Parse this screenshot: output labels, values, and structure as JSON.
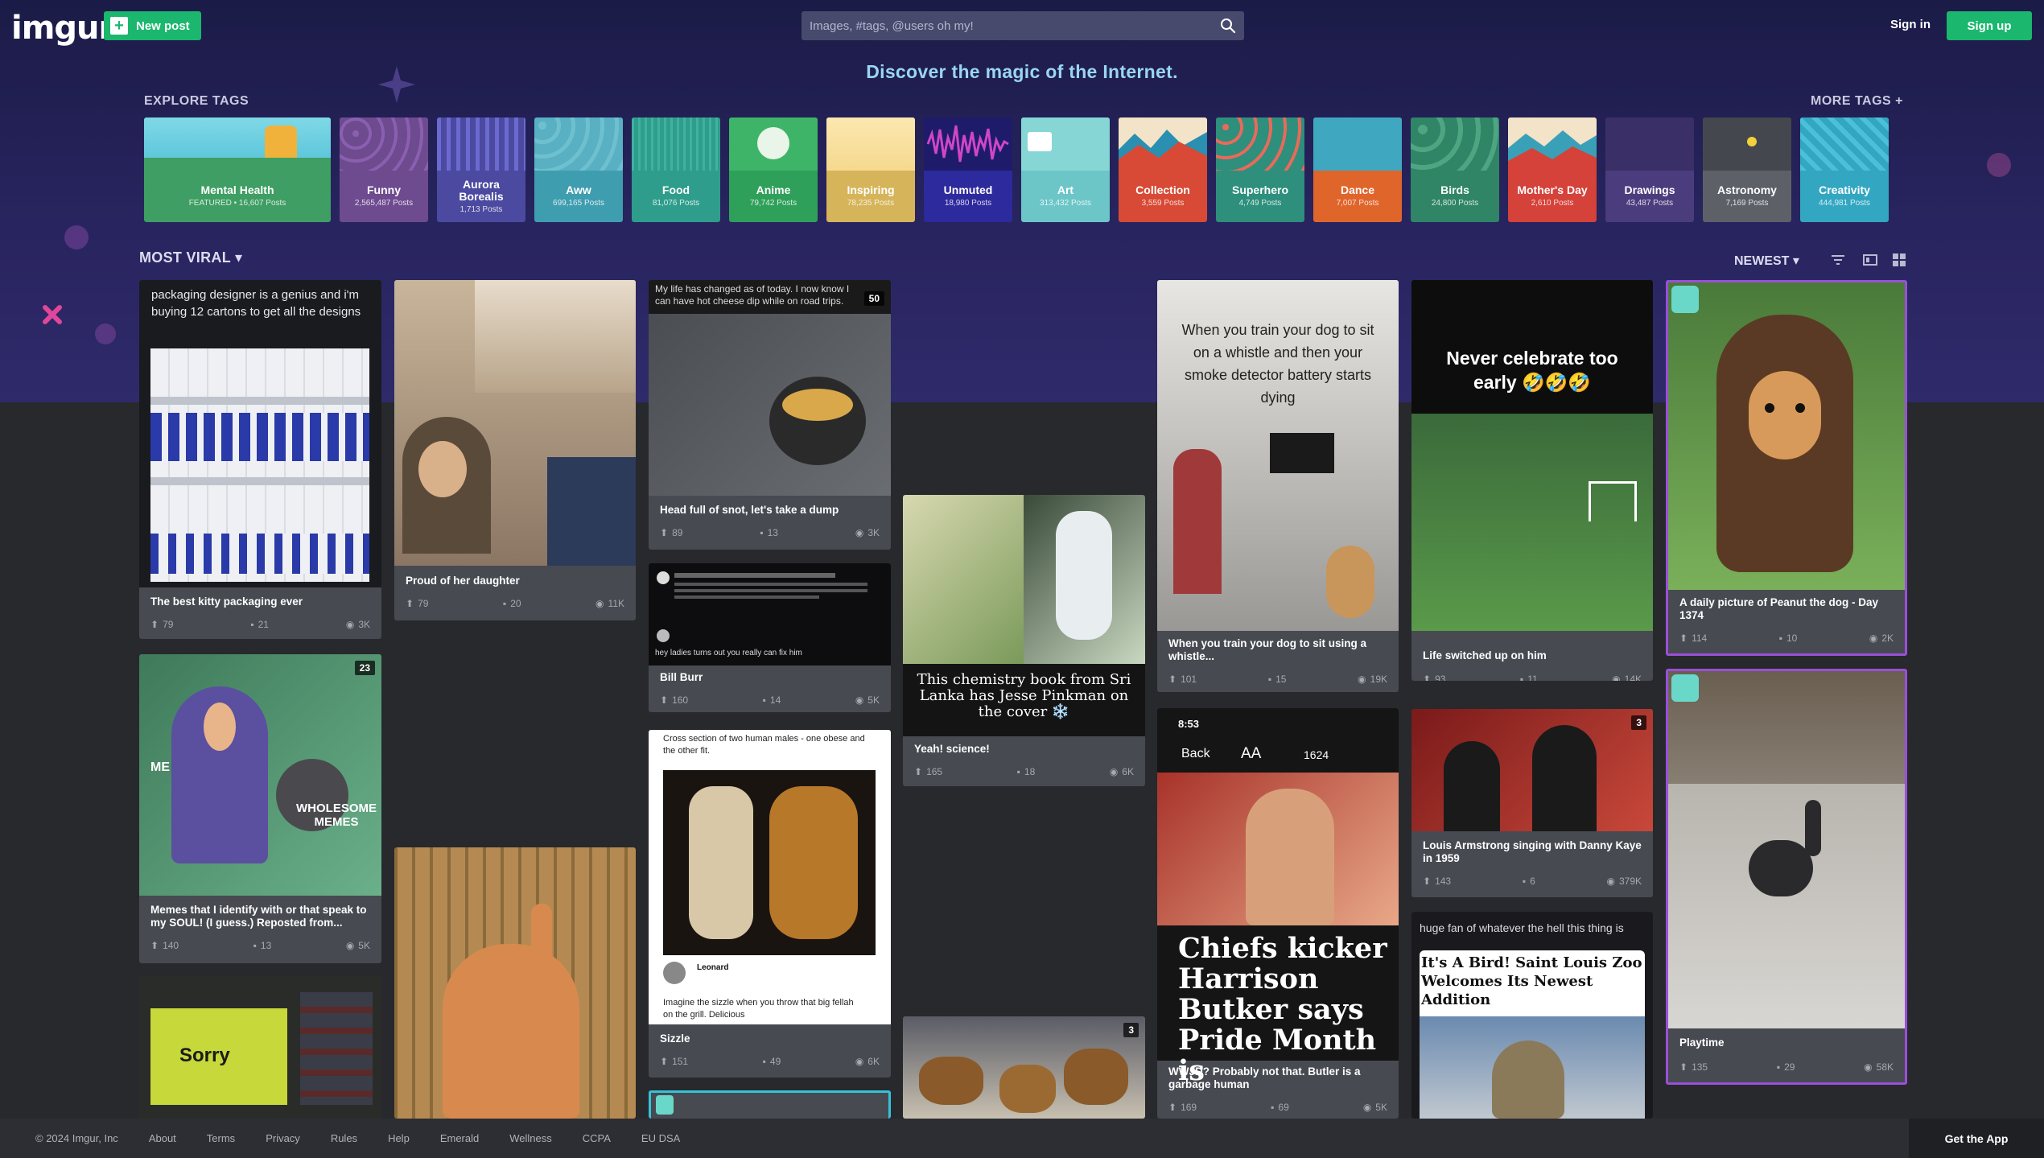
{
  "header": {
    "logo": "imgur",
    "new_post_label": "New post",
    "search_placeholder": "Images, #tags, @users oh my!",
    "sign_in": "Sign in",
    "sign_up": "Sign up",
    "tagline": "Discover the magic of the Internet."
  },
  "explore": {
    "label": "EXPLORE TAGS",
    "more": "MORE TAGS +",
    "tags": [
      {
        "name": "Mental Health",
        "count": "FEATURED • 16,607 Posts",
        "color": "#3f9e63"
      },
      {
        "name": "Funny",
        "count": "2,565,487 Posts",
        "color": "#6e4a8f"
      },
      {
        "name": "Aurora Borealis",
        "count": "1,713 Posts",
        "color": "#4b4aa0"
      },
      {
        "name": "Aww",
        "count": "699,165 Posts",
        "color": "#3f9db0"
      },
      {
        "name": "Food",
        "count": "81,076 Posts",
        "color": "#2f9d8b"
      },
      {
        "name": "Anime",
        "count": "79,742 Posts",
        "color": "#2fa05a"
      },
      {
        "name": "Inspiring",
        "count": "78,235 Posts",
        "color": "#d6b45a"
      },
      {
        "name": "Unmuted",
        "count": "18,980 Posts",
        "color": "#2c2a9c"
      },
      {
        "name": "Art",
        "count": "313,432 Posts",
        "color": "#6cc6c8"
      },
      {
        "name": "Collection",
        "count": "3,559 Posts",
        "color": "#d84a35"
      },
      {
        "name": "Superhero",
        "count": "4,749 Posts",
        "color": "#2d8f7c"
      },
      {
        "name": "Dance",
        "count": "7,007 Posts",
        "color": "#e0652b"
      },
      {
        "name": "Birds",
        "count": "24,800 Posts",
        "color": "#2f8566"
      },
      {
        "name": "Mother's Day",
        "count": "2,610 Posts",
        "color": "#d4423a"
      },
      {
        "name": "Drawings",
        "count": "43,487 Posts",
        "color": "#4b3d7d"
      },
      {
        "name": "Astronomy",
        "count": "7,169 Posts",
        "color": "#5e6068"
      },
      {
        "name": "Creativity",
        "count": "444,981 Posts",
        "color": "#33a7c2"
      }
    ]
  },
  "feed": {
    "sort": "MOST VIRAL",
    "order": "NEWEST",
    "posts": [
      {
        "title": "The best kitty packaging ever",
        "up": "79",
        "comments": "21",
        "views": "3K",
        "img_text": "packaging designer is a genius and i'm buying 12 cartons to get all the designs"
      },
      {
        "title": "Proud of her daughter",
        "up": "79",
        "comments": "20",
        "views": "11K"
      },
      {
        "title": "Head full of snot, let's take a dump",
        "up": "89",
        "comments": "13",
        "views": "3K",
        "img_text": "My life has changed as of today.  I now know I can have hot cheese dip while on road trips.",
        "badge": "50"
      },
      {
        "title": "Bill Burr",
        "up": "160",
        "comments": "14",
        "views": "5K",
        "img_text": "hey ladies turns out you really can fix him"
      },
      {
        "title": "Yeah! science!",
        "up": "165",
        "comments": "18",
        "views": "6K",
        "img_text": "This chemistry book from Sri Lanka has Jesse Pinkman on the cover ❄️"
      },
      {
        "title": "When you train your dog to sit using a whistle...",
        "up": "101",
        "comments": "15",
        "views": "19K",
        "img_text": "When you train your dog to sit on a whistle and then your smoke detector battery starts dying"
      },
      {
        "title": "Life switched up on him",
        "up": "93",
        "comments": "11",
        "views": "14K",
        "img_text": "Never celebrate too early 🤣🤣🤣"
      },
      {
        "title": "A daily picture of Peanut the dog - Day 1374",
        "up": "114",
        "comments": "10",
        "views": "2K"
      },
      {
        "title": "Memes that I identify with or that speak to my SOUL! (I guess.) Reposted from...",
        "up": "140",
        "comments": "13",
        "views": "5K",
        "img_text_a": "ME",
        "img_text_b": "WHOLESOME MEMES",
        "badge": "23"
      },
      {
        "title": "Sizzle",
        "up": "151",
        "comments": "49",
        "views": "6K",
        "img_text": "Cross section of two human males - one obese and the other fit.",
        "caption": "Imagine the sizzle when you throw that big fellah on the grill. Delicious",
        "author": "Leonard"
      },
      {
        "title": "WWJD? Probably not that. Butler is a garbage human",
        "up": "169",
        "comments": "69",
        "views": "5K",
        "img_text": "Chiefs kicker Harrison Butker says Pride Month is",
        "time": "8:53",
        "back": "Back",
        "aa": "AA",
        "count": "1624"
      },
      {
        "title": "Louis Armstrong singing with Danny Kaye in 1959",
        "up": "143",
        "comments": "6",
        "views": "379K",
        "badge": "3"
      },
      {
        "title": "Playtime",
        "up": "135",
        "comments": "29",
        "views": "58K"
      },
      {
        "img_text": "huge fan of whatever the hell this thing is",
        "headline": "It's A Bird! Saint Louis Zoo Welcomes Its Newest Addition"
      },
      {
        "img_text": "Sorry"
      },
      {
        "badge": "3"
      }
    ]
  },
  "footer": {
    "copyright": "© 2024 Imgur, Inc",
    "links": [
      "About",
      "Terms",
      "Privacy",
      "Rules",
      "Help",
      "Emerald",
      "Wellness",
      "CCPA",
      "EU DSA"
    ],
    "get_app": "Get the App"
  }
}
